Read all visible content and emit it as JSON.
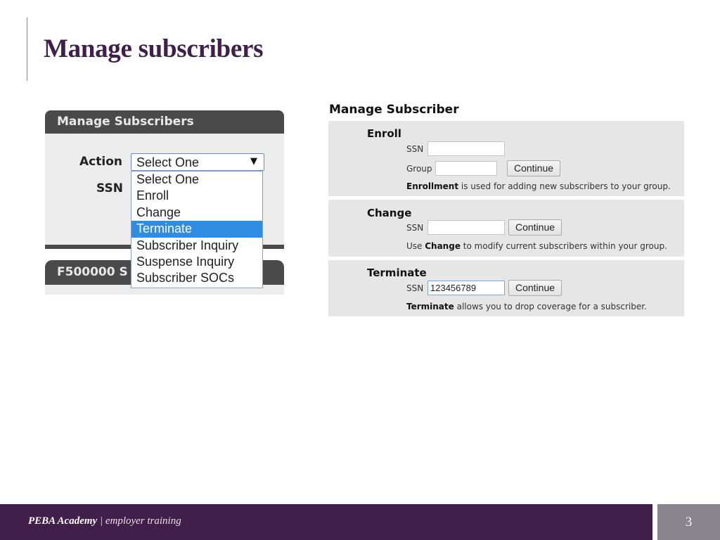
{
  "slide": {
    "title": "Manage subscribers",
    "page_number": "3"
  },
  "left_panel": {
    "header": "Manage Subscribers",
    "action_label": "Action",
    "ssn_label": "SSN",
    "select_value": "Select One",
    "select_arrow": "▼",
    "dropdown_options": [
      "Select One",
      "Enroll",
      "Change",
      "Terminate",
      "Subscriber Inquiry",
      "Suspense Inquiry",
      "Subscriber SOCs"
    ],
    "highlighted_option": "Terminate",
    "second_header": "F500000 S"
  },
  "right_panel": {
    "title": "Manage Subscriber",
    "enroll": {
      "heading": "Enroll",
      "ssn_label": "SSN",
      "ssn_value": "",
      "group_label": "Group",
      "group_value": "",
      "button": "Continue",
      "desc_bold": "Enrollment",
      "desc_rest": " is used for adding new subscribers to your group."
    },
    "change": {
      "heading": "Change",
      "ssn_label": "SSN",
      "ssn_value": "",
      "button": "Continue",
      "desc_pre": "Use ",
      "desc_bold": "Change",
      "desc_rest": " to modify current subscribers within your group."
    },
    "terminate": {
      "heading": "Terminate",
      "ssn_label": "SSN",
      "ssn_value": "123456789",
      "button": "Continue",
      "desc_bold": "Terminate",
      "desc_rest": " allows you to drop coverage for a subscriber."
    }
  },
  "footer": {
    "brand": "PEBA Academy",
    "separator": " | ",
    "tagline": "employer training"
  },
  "colors": {
    "title": "#3f1f4b",
    "footer_bg": "#421f4a",
    "page_box_bg": "#8a848e",
    "selected_option": "#2f8ce3",
    "panel_header": "#4a4a4a"
  }
}
